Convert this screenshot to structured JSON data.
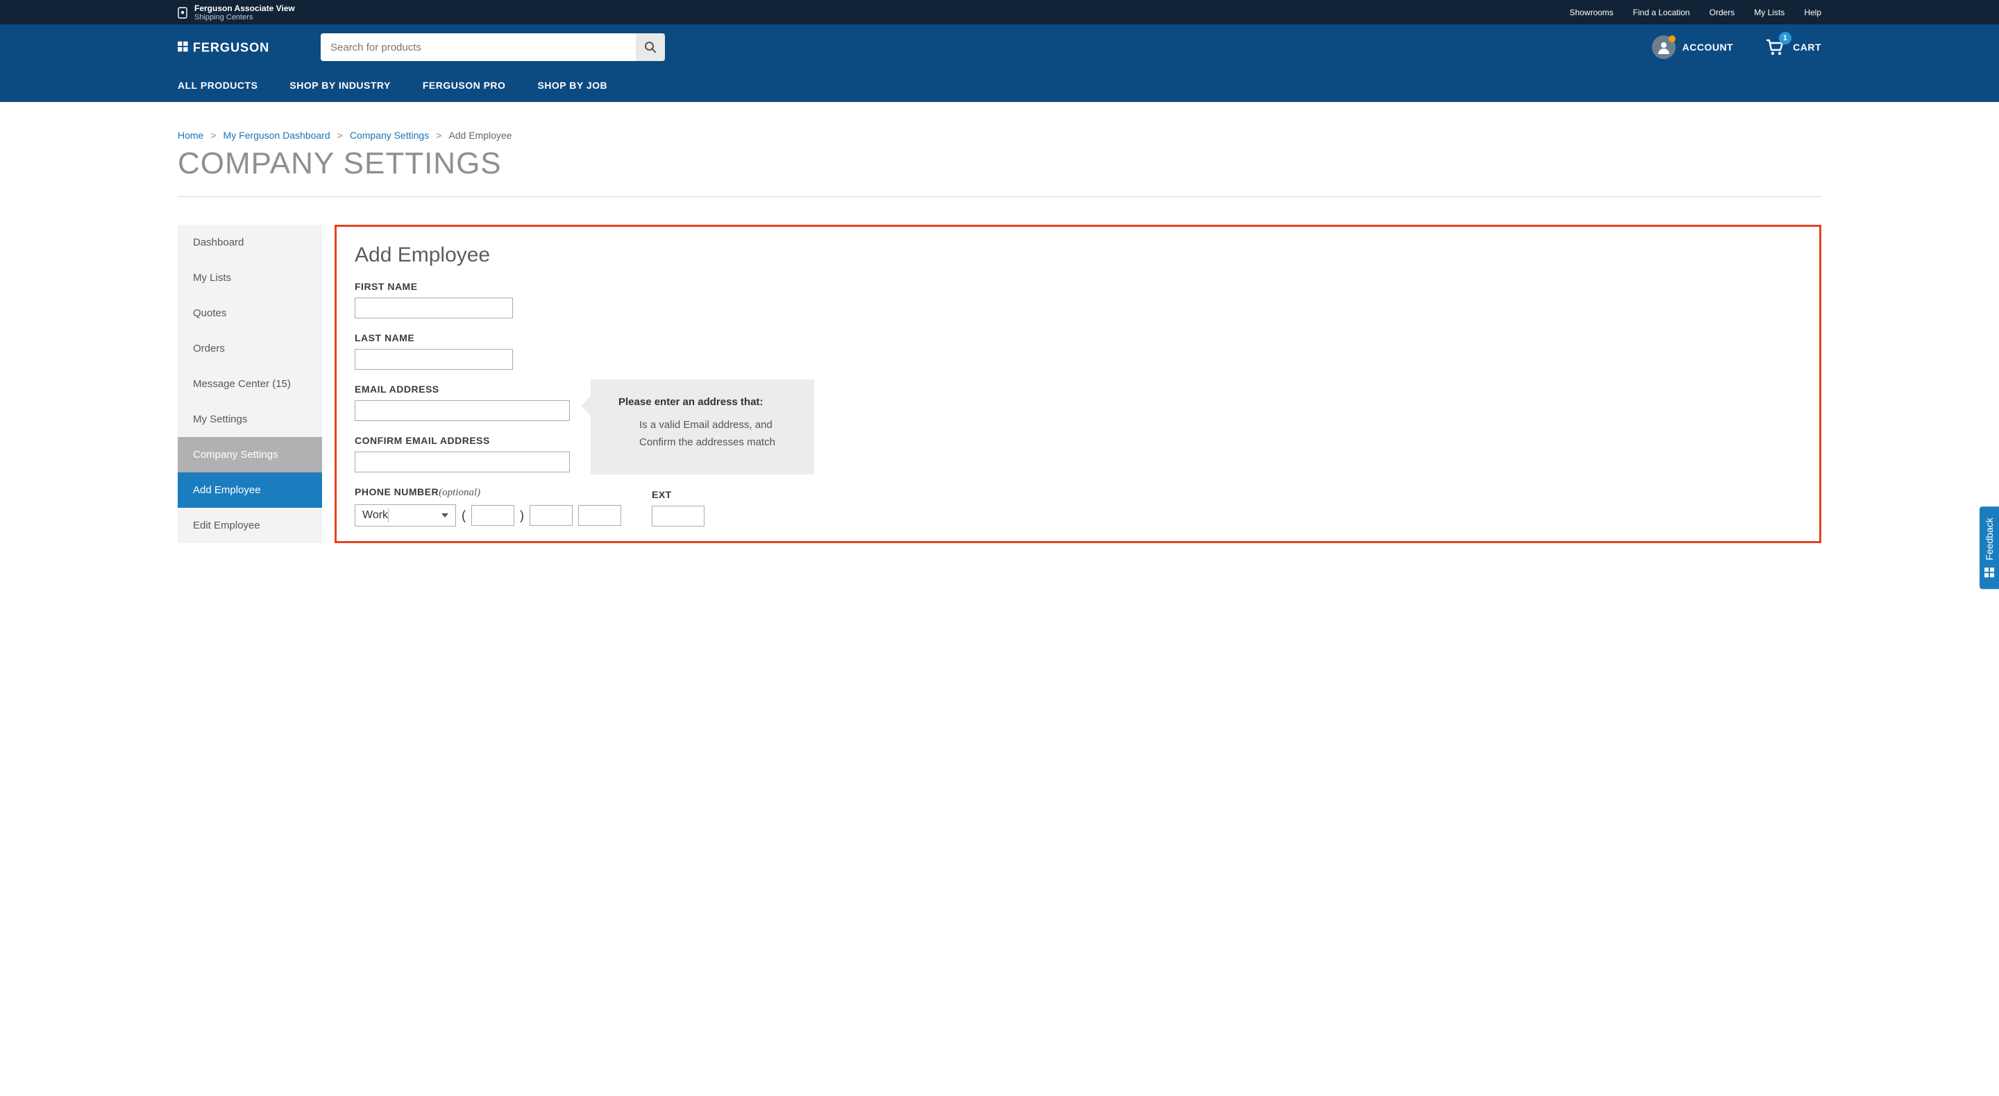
{
  "topbar": {
    "assoc_title": "Ferguson Associate View",
    "assoc_sub": "Shipping Centers",
    "links": [
      "Showrooms",
      "Find a Location",
      "Orders",
      "My Lists",
      "Help"
    ]
  },
  "header": {
    "logo_text": "FERGUSON",
    "search_placeholder": "Search for products",
    "account_label": "ACCOUNT",
    "cart_label": "CART",
    "cart_count": "1"
  },
  "nav": {
    "items": [
      "ALL PRODUCTS",
      "SHOP BY INDUSTRY",
      "FERGUSON PRO",
      "SHOP BY JOB"
    ]
  },
  "breadcrumb": {
    "items": [
      {
        "label": "Home",
        "link": true
      },
      {
        "label": "My Ferguson Dashboard",
        "link": true
      },
      {
        "label": "Company Settings",
        "link": true
      },
      {
        "label": "Add Employee",
        "link": false
      }
    ]
  },
  "page_title": "COMPANY SETTINGS",
  "sidebar": {
    "items": [
      {
        "label": "Dashboard",
        "type": "item"
      },
      {
        "label": "My Lists",
        "type": "item"
      },
      {
        "label": "Quotes",
        "type": "item"
      },
      {
        "label": "Orders",
        "type": "item"
      },
      {
        "label": "Message Center (15)",
        "type": "item"
      },
      {
        "label": "My Settings",
        "type": "item"
      },
      {
        "label": "Company Settings",
        "type": "parent"
      },
      {
        "label": "Add Employee",
        "type": "active-sub"
      },
      {
        "label": "Edit Employee",
        "type": "sub"
      }
    ]
  },
  "form": {
    "title": "Add Employee",
    "first_name_label": "FIRST NAME",
    "last_name_label": "LAST NAME",
    "email_label": "EMAIL ADDRESS",
    "confirm_email_label": "CONFIRM EMAIL ADDRESS",
    "phone_label": "PHONE NUMBER",
    "phone_optional": "(optional)",
    "phone_type": "Work",
    "ext_label": "EXT",
    "tip_title": "Please enter an address that:",
    "tip_line1": "Is a valid Email address, and",
    "tip_line2": "Confirm the addresses match"
  },
  "feedback_label": "Feedback",
  "colors": {
    "brand_dark": "#102337",
    "brand_blue": "#0c4a82",
    "accent_blue": "#1b7dc0",
    "highlight_red": "#e6431f"
  }
}
